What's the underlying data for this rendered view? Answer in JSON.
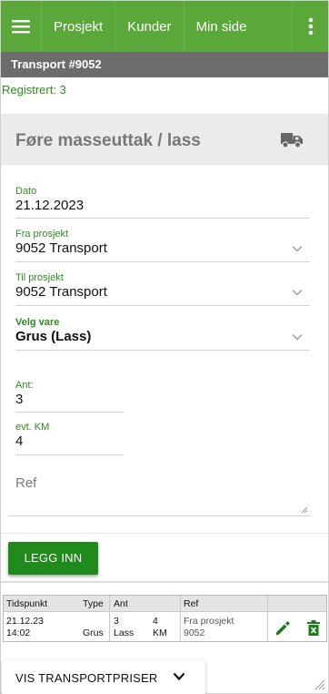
{
  "nav": {
    "items": [
      "Prosjekt",
      "Kunder",
      "Min side"
    ]
  },
  "page": {
    "title": "Transport #9052",
    "registered": "Registrert: 3"
  },
  "form": {
    "heading": "Føre masseuttak / lass",
    "date": {
      "label": "Dato",
      "value": "21.12.2023"
    },
    "from_project": {
      "label": "Fra prosjekt",
      "value": "9052 Transport"
    },
    "to_project": {
      "label": "Til prosjekt",
      "value": "9052 Transport"
    },
    "item": {
      "label": "Velg vare",
      "value": "Grus (Lass)"
    },
    "quantity": {
      "label": "Ant:",
      "value": "3"
    },
    "km": {
      "label": "evt. KM",
      "value": "4"
    },
    "ref": {
      "placeholder": "Ref"
    },
    "submit_label": "LEGG INN"
  },
  "log": {
    "headers": {
      "time": "Tidspunkt",
      "type": "Type",
      "qty": "Ant",
      "ref": "Ref"
    },
    "rows": [
      {
        "date": "21.12.23",
        "time": "14:02",
        "type": "Grus",
        "qty": "3",
        "unit": "Lass",
        "km": "4",
        "km_unit": "KM",
        "ref_line1": "Fra prosjekt",
        "ref_line2": "9052"
      }
    ]
  },
  "prices_toggle_label": "VIS TRANSPORTPRISER",
  "colors": {
    "topbar": "#5aa73a",
    "titlebar": "#6c6c6c",
    "accent_green": "#2e8a22",
    "button": "#218a1c"
  },
  "icons": [
    "menu-icon",
    "more-vert-icon",
    "truck-icon",
    "chevron-down-icon",
    "pencil-icon",
    "delete-icon",
    "resize-grip-icon"
  ]
}
